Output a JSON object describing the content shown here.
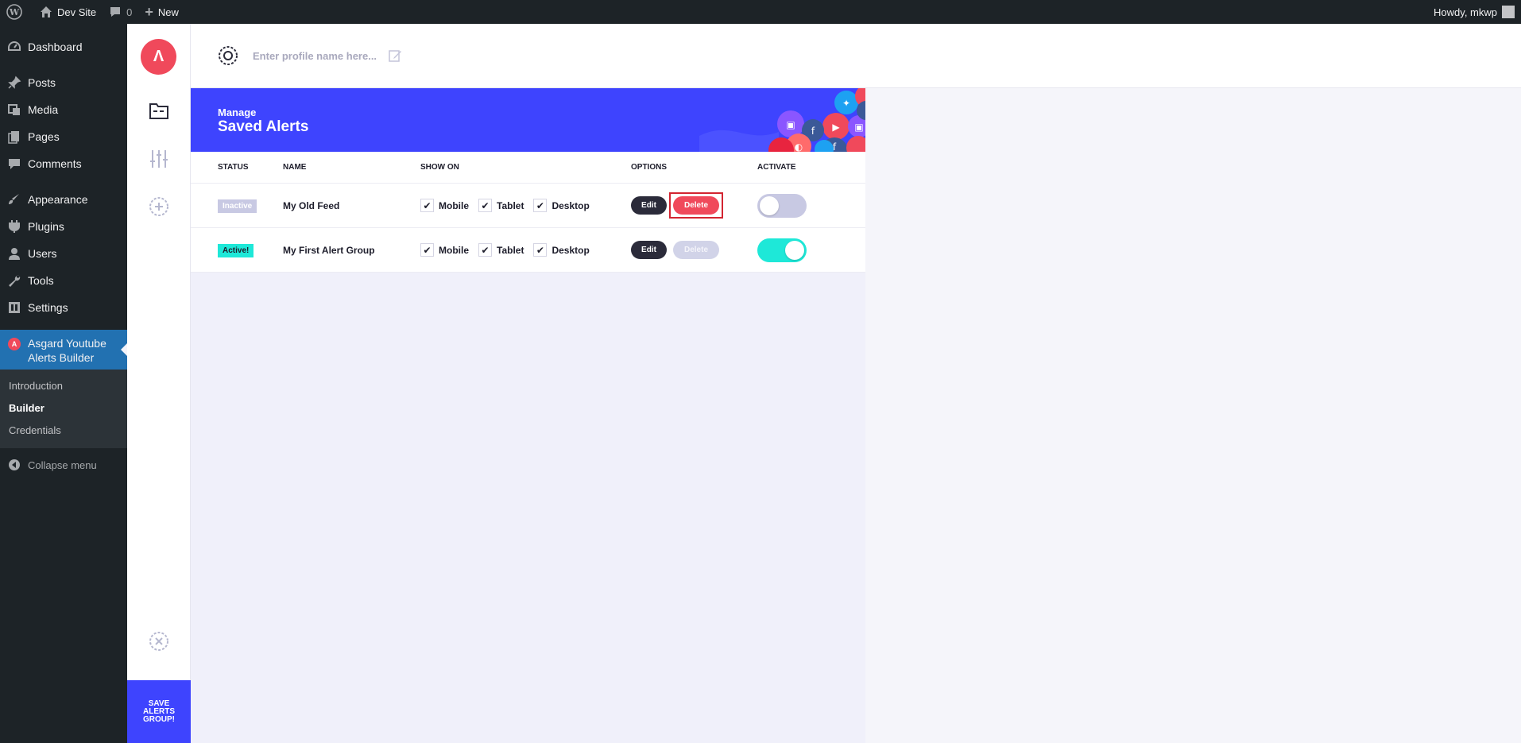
{
  "admin_bar": {
    "site_name": "Dev Site",
    "comments_count": "0",
    "new_label": "New",
    "greeting": "Howdy, mkwp"
  },
  "sidebar": {
    "items": [
      {
        "label": "Dashboard",
        "icon": "dashboard-icon"
      },
      {
        "label": "Posts",
        "icon": "pin-icon"
      },
      {
        "label": "Media",
        "icon": "media-icon"
      },
      {
        "label": "Pages",
        "icon": "pages-icon"
      },
      {
        "label": "Comments",
        "icon": "comment-icon"
      },
      {
        "label": "Appearance",
        "icon": "brush-icon"
      },
      {
        "label": "Plugins",
        "icon": "plugin-icon"
      },
      {
        "label": "Users",
        "icon": "user-icon"
      },
      {
        "label": "Tools",
        "icon": "wrench-icon"
      },
      {
        "label": "Settings",
        "icon": "settings-icon"
      }
    ],
    "current": {
      "label_line1": "Asgard Youtube",
      "label_line2": "Alerts Builder",
      "icon_letter": "A"
    },
    "submenu": [
      "Introduction",
      "Builder",
      "Credentials"
    ],
    "collapse_label": "Collapse menu"
  },
  "plugin_nav": {
    "logo_letter": "Λ",
    "save_label": "SAVE ALERTS GROUP!"
  },
  "profile": {
    "placeholder": "Enter profile name here..."
  },
  "banner": {
    "subtitle": "Manage",
    "title": "Saved Alerts"
  },
  "table": {
    "headers": {
      "status": "STATUS",
      "name": "NAME",
      "show_on": "SHOW ON",
      "options": "OPTIONS",
      "activate": "ACTIVATE"
    },
    "show_on_labels": [
      "Mobile",
      "Tablet",
      "Desktop"
    ],
    "edit_label": "Edit",
    "delete_label": "Delete",
    "rows": [
      {
        "status": "Inactive",
        "name": "My Old Feed",
        "active": false
      },
      {
        "status": "Active!",
        "name": "My First Alert Group",
        "active": true
      }
    ]
  },
  "colors": {
    "accent": "#3e44fe",
    "danger": "#f0495b",
    "active": "#1ee8d8",
    "wp_current": "#2271b1"
  }
}
